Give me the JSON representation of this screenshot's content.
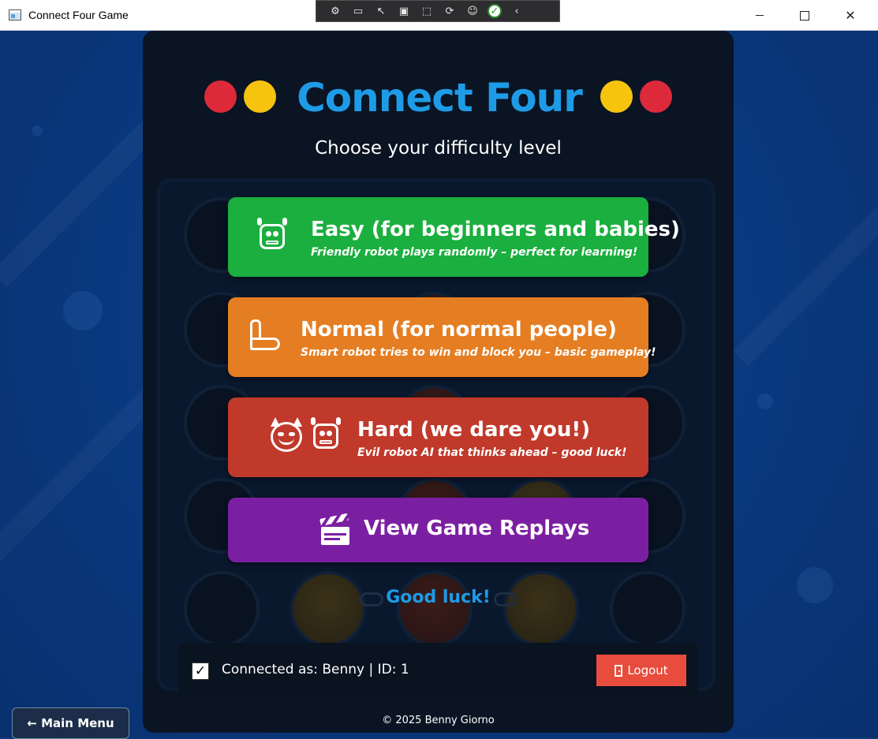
{
  "window": {
    "title": "Connect Four Game",
    "minimize": "",
    "maximize": "",
    "close": "✕"
  },
  "app": {
    "title": "Connect Four",
    "subtitle": "Choose your difficulty level"
  },
  "buttons": {
    "easy": {
      "label": "Easy (for beginners and babies)",
      "description": "Friendly robot plays randomly – perfect for learning!",
      "icon": "robot-icon",
      "color": "#1aaf3e"
    },
    "normal": {
      "label": "Normal (for normal people)",
      "description": "Smart robot tries to win and block you – basic gameplay!",
      "icon": "flexed-arm-icon",
      "color": "#e57e22"
    },
    "hard": {
      "label": "Hard (we dare you!)",
      "description": "Evil robot AI that thinks ahead – good luck!",
      "icon": "devil-robot-icon",
      "color": "#c0392b"
    },
    "replays": {
      "label": "View Game Replays",
      "icon": "clapperboard-icon",
      "color": "#7b1fa2"
    }
  },
  "good_luck": "Good luck!",
  "status": {
    "text": "Connected as: Benny | ID: 1",
    "checked": "✓",
    "logout_label": "Logout"
  },
  "footer": "© 2025  Benny Giorno",
  "nav": {
    "main_menu_label": "← Main Menu"
  },
  "colors": {
    "title": "#1e9be6",
    "disc_red": "#dc2a3a",
    "disc_yellow": "#f6c40f",
    "logout": "#e74c3c"
  }
}
